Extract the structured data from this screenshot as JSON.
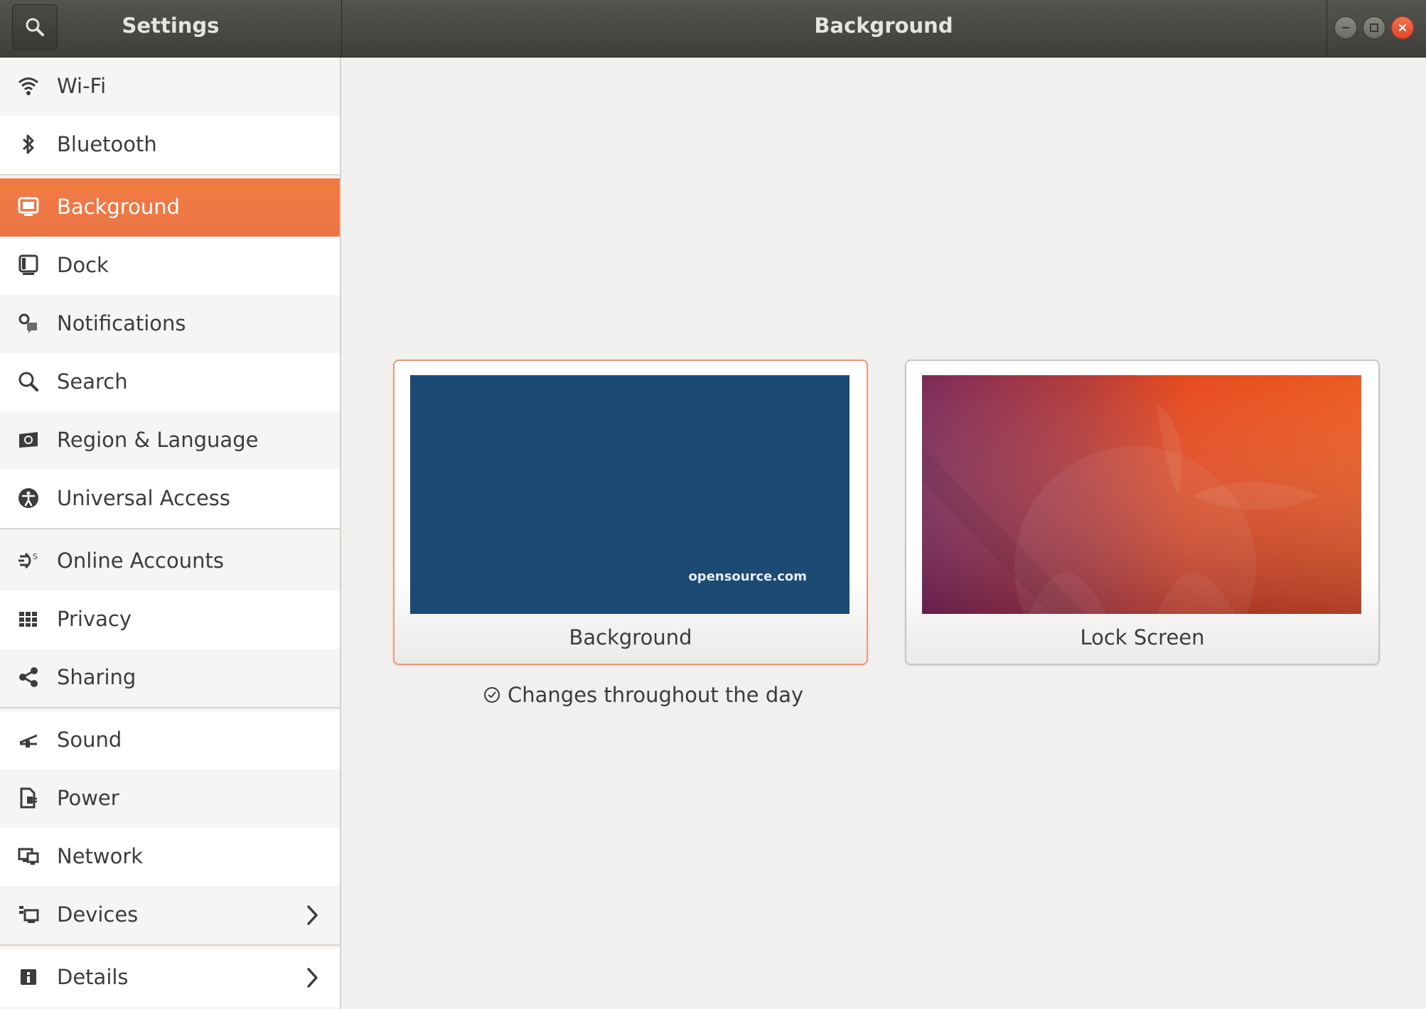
{
  "header": {
    "app_title": "Settings",
    "page_title": "Background",
    "window_controls": [
      "minimize",
      "maximize",
      "close"
    ]
  },
  "sidebar": {
    "items": [
      {
        "label": "Wi-Fi",
        "icon": "wifi-icon"
      },
      {
        "label": "Bluetooth",
        "icon": "bluetooth-icon"
      },
      {
        "label": "Background",
        "icon": "background-icon",
        "active": true
      },
      {
        "label": "Dock",
        "icon": "dock-icon"
      },
      {
        "label": "Notifications",
        "icon": "notifications-icon"
      },
      {
        "label": "Search",
        "icon": "search-icon"
      },
      {
        "label": "Region & Language",
        "icon": "region-language-icon"
      },
      {
        "label": "Universal Access",
        "icon": "universal-access-icon"
      },
      {
        "label": "Online Accounts",
        "icon": "online-accounts-icon"
      },
      {
        "label": "Privacy",
        "icon": "privacy-icon"
      },
      {
        "label": "Sharing",
        "icon": "sharing-icon"
      },
      {
        "label": "Sound",
        "icon": "sound-icon"
      },
      {
        "label": "Power",
        "icon": "power-icon"
      },
      {
        "label": "Network",
        "icon": "network-icon"
      },
      {
        "label": "Devices",
        "icon": "devices-icon",
        "has_submenu": true
      },
      {
        "label": "Details",
        "icon": "details-icon",
        "has_submenu": true
      }
    ]
  },
  "main": {
    "background_card": {
      "label": "Background",
      "watermark": "opensource.com",
      "color": "#1b4a74"
    },
    "lock_card": {
      "label": "Lock Screen"
    },
    "changes_text": "Changes throughout the day"
  },
  "colors": {
    "accent": "#ee7546",
    "headerbar": "#45443f",
    "close_button": "#e9512f"
  }
}
